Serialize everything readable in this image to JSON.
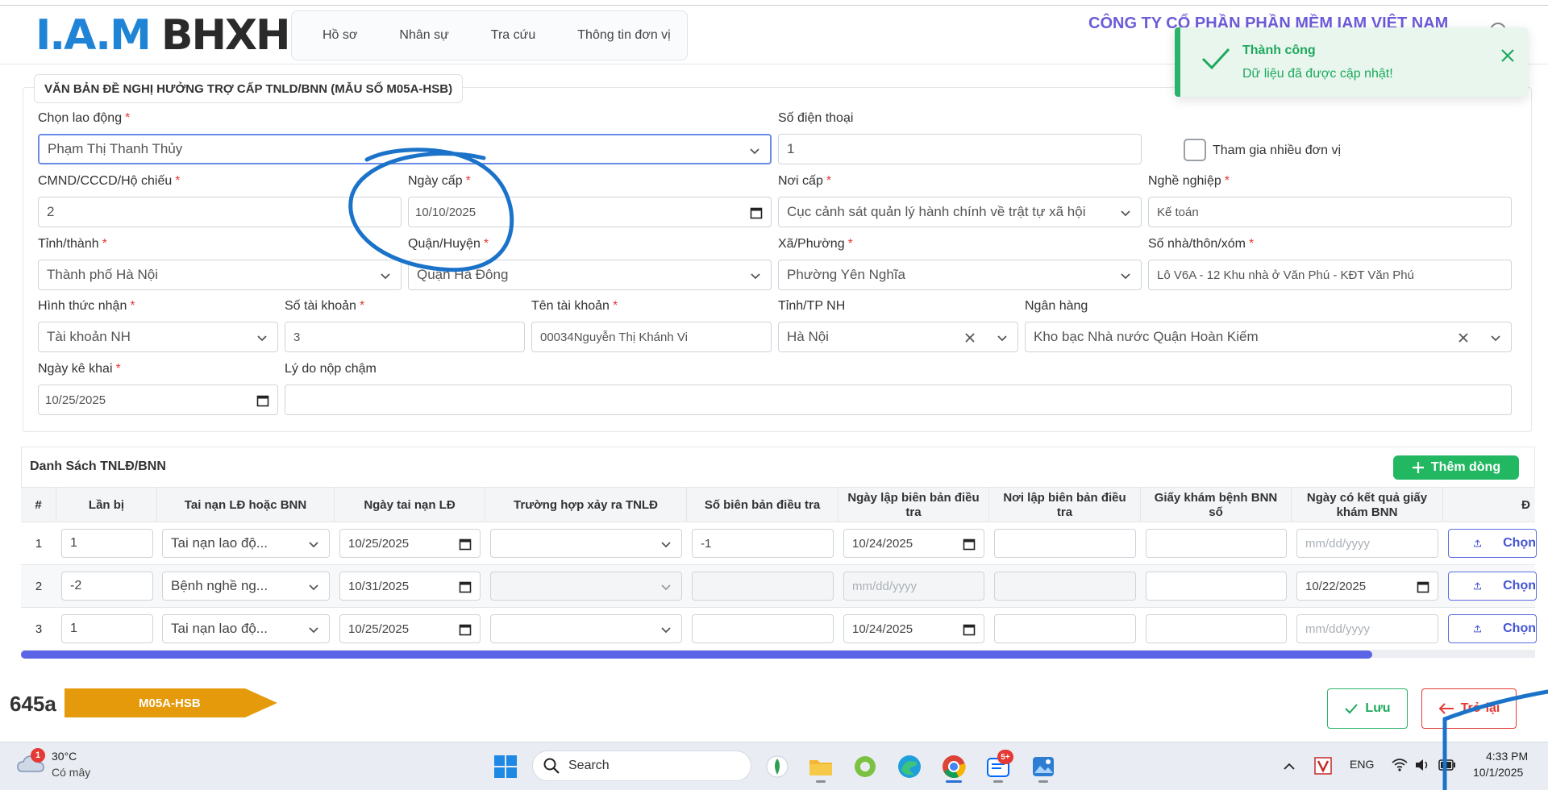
{
  "header": {
    "logo_iam": "I.A.M",
    "logo_bhxh": "BHXH",
    "nav": [
      "Hồ sơ",
      "Nhân sự",
      "Tra cứu",
      "Thông tin đơn vị"
    ],
    "company": "CÔNG TY CỔ PHẦN PHẦN MỀM IAM VIỆT NAM"
  },
  "toast": {
    "title": "Thành công",
    "message": "Dữ liệu đã được cập nhật!"
  },
  "form": {
    "title": "VĂN BẢN ĐỀ NGHỊ HƯỞNG TRỢ CẤP TNLD/BNN (MẪU SỐ M05A-HSB)",
    "required_mark": "*",
    "employee_label": "Chọn lao động",
    "employee_value": "Phạm Thị Thanh Thủy",
    "phone_label": "Số điện thoại",
    "phone_value": "1",
    "multi_unit_label": "Tham gia nhiều đơn vị",
    "id_label": "CMND/CCCD/Hộ chiếu",
    "id_value": "2",
    "issue_date_label": "Ngày cấp",
    "issue_date_value": "10/10/2025",
    "issue_place_label": "Nơi cấp",
    "issue_place_value": "Cục cảnh sát quản lý hành chính về trật tự xã hội",
    "job_label": "Nghề nghiệp",
    "job_value": "Kế toán",
    "province_label": "Tỉnh/thành",
    "province_value": "Thành phố Hà Nội",
    "district_label": "Quận/Huyện",
    "district_value": "Quận Hà Đông",
    "ward_label": "Xã/Phường",
    "ward_value": "Phường Yên Nghĩa",
    "address_label": "Số nhà/thôn/xóm",
    "address_value": "Lô V6A - 12 Khu nhà ở Văn Phú - KĐT Văn Phú",
    "receive_method_label": "Hình thức nhận",
    "receive_method_value": "Tài khoản NH",
    "account_no_label": "Số tài khoản",
    "account_no_value": "3",
    "account_name_label": "Tên tài khoản",
    "account_name_value": "00034Nguyễn Thị Khánh Vi",
    "bank_province_label": "Tỉnh/TP NH",
    "bank_province_value": "Hà Nội",
    "bank_label": "Ngân hàng",
    "bank_value": "Kho bạc Nhà nước Quận Hoàn Kiếm",
    "declare_date_label": "Ngày kê khai",
    "declare_date_value": "10/25/2025",
    "late_reason_label": "Lý do nộp chậm",
    "late_reason_value": ""
  },
  "table": {
    "title": "Danh Sách TNLĐ/BNN",
    "add_button": "Thêm dòng",
    "date_placeholder": "mm/dd/yyyy",
    "choose_label": "Chọn",
    "headers": [
      "#",
      "Lần bị",
      "Tai nạn LĐ hoặc BNN",
      "Ngày tai nạn LĐ",
      "Trường hợp xảy ra TNLĐ",
      "Số biên bản điều tra",
      "Ngày lập biên bản điều tra",
      "Nơi lập biên bản điều tra",
      "Giấy khám bệnh BNN số",
      "Ngày có kết quả giấy khám BNN",
      "Đ"
    ],
    "rows": [
      {
        "num": "1",
        "times": "1",
        "type": "Tai nạn lao độ...",
        "accident_date": "10/25/2025",
        "case": "",
        "report_no": "-1",
        "report_date": "10/24/2025",
        "report_place": "",
        "exam_no": "",
        "exam_date": ""
      },
      {
        "num": "2",
        "times": "-2",
        "type": "Bệnh nghề ng...",
        "accident_date": "10/31/2025",
        "case": "",
        "report_no": "",
        "report_date": "",
        "report_place": "",
        "exam_no": "",
        "exam_date": "10/22/2025"
      },
      {
        "num": "3",
        "times": "1",
        "type": "Tai nạn lao độ...",
        "accident_date": "10/25/2025",
        "case": "",
        "report_no": "",
        "report_date": "10/24/2025",
        "report_place": "",
        "exam_no": "",
        "exam_date": ""
      }
    ]
  },
  "footer": {
    "doc_id": "645a",
    "form_tag": "M05A-HSB",
    "save_label": "Lưu",
    "back_label": "Trở lại"
  },
  "taskbar": {
    "weather_badge": "1",
    "temperature": "30°C",
    "condition": "Có mây",
    "search_label": "Search",
    "zalo_badge": "5+",
    "language": "ENG",
    "time": "4:33 PM",
    "date": "10/1/2025"
  },
  "colors": {
    "brand_blue": "#1f84d6",
    "success_green": "#22b862",
    "danger_red": "#e53935",
    "accent_purple": "#5b63e6",
    "tag_orange": "#e59a0c",
    "annotation_blue": "#1a73c9"
  }
}
